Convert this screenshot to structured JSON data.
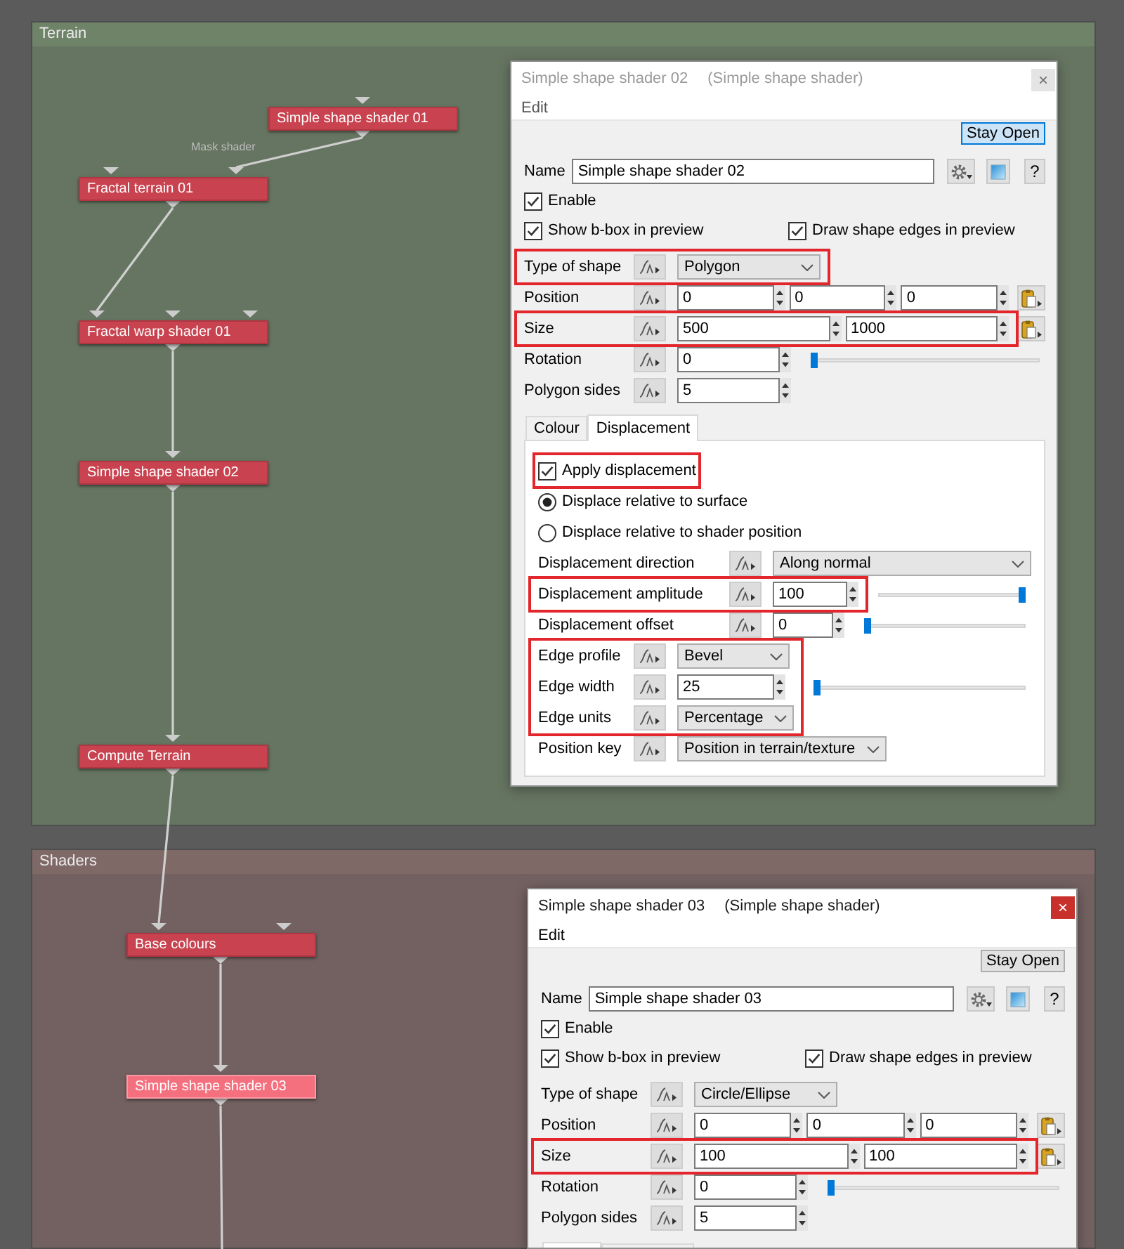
{
  "canvas": {
    "panels": [
      {
        "title": "Terrain",
        "color": "#6f8369",
        "nodes": [
          {
            "label": "Simple shape shader 01",
            "selected": false
          },
          {
            "label": "Fractal terrain 01",
            "selected": false
          },
          {
            "label": "Fractal warp shader 01",
            "selected": false
          },
          {
            "label": "Simple shape shader 02",
            "selected": false
          },
          {
            "label": "Compute Terrain",
            "selected": false
          }
        ]
      },
      {
        "title": "Shaders",
        "color": "#7f6967",
        "nodes": [
          {
            "label": "Base colours",
            "selected": false
          },
          {
            "label": "Simple shape shader 03",
            "selected": true
          }
        ]
      }
    ],
    "wire_labels": [
      "Mask shader"
    ]
  },
  "dialogs": [
    {
      "title": "Simple shape shader 02",
      "subtitle": "(Simple shape shader)",
      "active": false,
      "close_button": "×",
      "menu": [
        "Edit"
      ],
      "stay_open": {
        "label": "Stay Open",
        "pressed": true
      },
      "name": {
        "label": "Name",
        "value": "Simple shape shader 02"
      },
      "help_button": "?",
      "checkboxes": [
        [
          {
            "label": "Enable",
            "checked": true
          }
        ],
        [
          {
            "label": "Show b-box in preview",
            "checked": true
          },
          {
            "label": "Draw shape edges in preview",
            "checked": true
          }
        ]
      ],
      "fields": [
        {
          "kind": "dropdown",
          "label": "Type of shape",
          "value": "Polygon",
          "highlighted": true
        },
        {
          "kind": "vector",
          "label": "Position",
          "values": [
            "0",
            "0",
            "0"
          ],
          "highlighted": false
        },
        {
          "kind": "vector",
          "label": "Size",
          "values": [
            "500",
            "1000"
          ],
          "highlighted": true
        },
        {
          "kind": "slider",
          "label": "Rotation",
          "value": "0",
          "level": 0,
          "highlighted": false
        },
        {
          "kind": "number",
          "label": "Polygon sides",
          "value": "5",
          "highlighted": false
        }
      ],
      "tabs": [
        {
          "label": "Colour",
          "selected": false
        },
        {
          "label": "Displacement",
          "selected": true
        }
      ],
      "tab_panel": {
        "options": [
          {
            "kind": "checkbox",
            "label": "Apply displacement",
            "checked": true,
            "highlighted": true
          },
          {
            "kind": "radio",
            "label": "Displace relative to surface",
            "selected": true,
            "highlighted": false
          },
          {
            "kind": "radio",
            "label": "Displace relative to shader position",
            "selected": false,
            "highlighted": false
          }
        ],
        "groups": [
          [
            {
              "kind": "dropdown",
              "label": "Displacement direction",
              "value": "Along normal",
              "highlighted": false
            },
            {
              "kind": "slider",
              "label": "Displacement amplitude",
              "value": "100",
              "level": 1,
              "highlighted": true
            },
            {
              "kind": "slider",
              "label": "Displacement offset",
              "value": "0",
              "level": 0,
              "highlighted": false
            }
          ],
          [
            {
              "kind": "dropdown",
              "label": "Edge profile",
              "value": "Bevel",
              "highlighted": true
            },
            {
              "kind": "slider",
              "label": "Edge width",
              "value": "25",
              "level": 0,
              "highlighted": true
            },
            {
              "kind": "dropdown",
              "label": "Edge units",
              "value": "Percentage",
              "highlighted": true
            },
            {
              "kind": "dropdown",
              "label": "Position key",
              "value": "Position in terrain/texture",
              "highlighted": false
            }
          ]
        ]
      }
    },
    {
      "title": "Simple shape shader 03",
      "subtitle": "(Simple shape shader)",
      "active": true,
      "close_button": "×",
      "menu": [
        "Edit"
      ],
      "stay_open": {
        "label": "Stay Open",
        "pressed": false
      },
      "name": {
        "label": "Name",
        "value": "Simple shape shader 03"
      },
      "help_button": "?",
      "checkboxes": [
        [
          {
            "label": "Enable",
            "checked": true
          }
        ],
        [
          {
            "label": "Show b-box in preview",
            "checked": true
          },
          {
            "label": "Draw shape edges in preview",
            "checked": true
          }
        ]
      ],
      "fields": [
        {
          "kind": "dropdown",
          "label": "Type of shape",
          "value": "Circle/Ellipse",
          "highlighted": false
        },
        {
          "kind": "vector",
          "label": "Position",
          "values": [
            "0",
            "0",
            "0"
          ],
          "highlighted": false
        },
        {
          "kind": "vector",
          "label": "Size",
          "values": [
            "100",
            "100"
          ],
          "highlighted": true
        },
        {
          "kind": "slider",
          "label": "Rotation",
          "value": "0",
          "level": 0,
          "highlighted": false
        },
        {
          "kind": "number",
          "label": "Polygon sides",
          "value": "5",
          "highlighted": false
        }
      ],
      "tabs": [
        {
          "selected": true
        },
        {
          "selected": false
        }
      ]
    }
  ]
}
